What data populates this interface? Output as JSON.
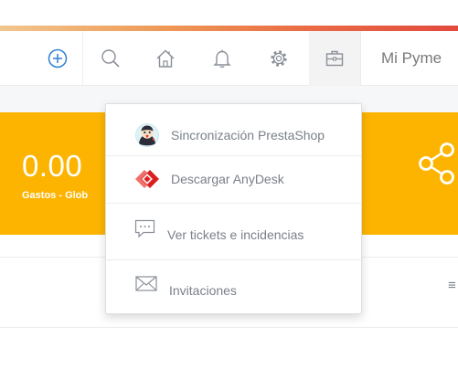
{
  "topbar": {
    "user_name": "Mi Pyme",
    "icons": [
      "add-circle-icon",
      "search-icon",
      "home-icon",
      "bell-icon",
      "gear-icon",
      "briefcase-icon"
    ]
  },
  "card": {
    "value": "0.00",
    "label": "Gastos - Glob"
  },
  "dropdown": {
    "items": [
      {
        "label": "Sincronización PrestaShop",
        "icon": "prestashop-icon"
      },
      {
        "label": "Descargar AnyDesk",
        "icon": "anydesk-icon"
      },
      {
        "label": "Ver tickets e incidencias",
        "icon": "chat-icon"
      },
      {
        "label": "Invitaciones",
        "icon": "envelope-icon"
      }
    ]
  },
  "colors": {
    "accent_yellow": "#fcb400",
    "accent_blue": "#2f7fd1",
    "muted_text": "#7a7f88"
  }
}
